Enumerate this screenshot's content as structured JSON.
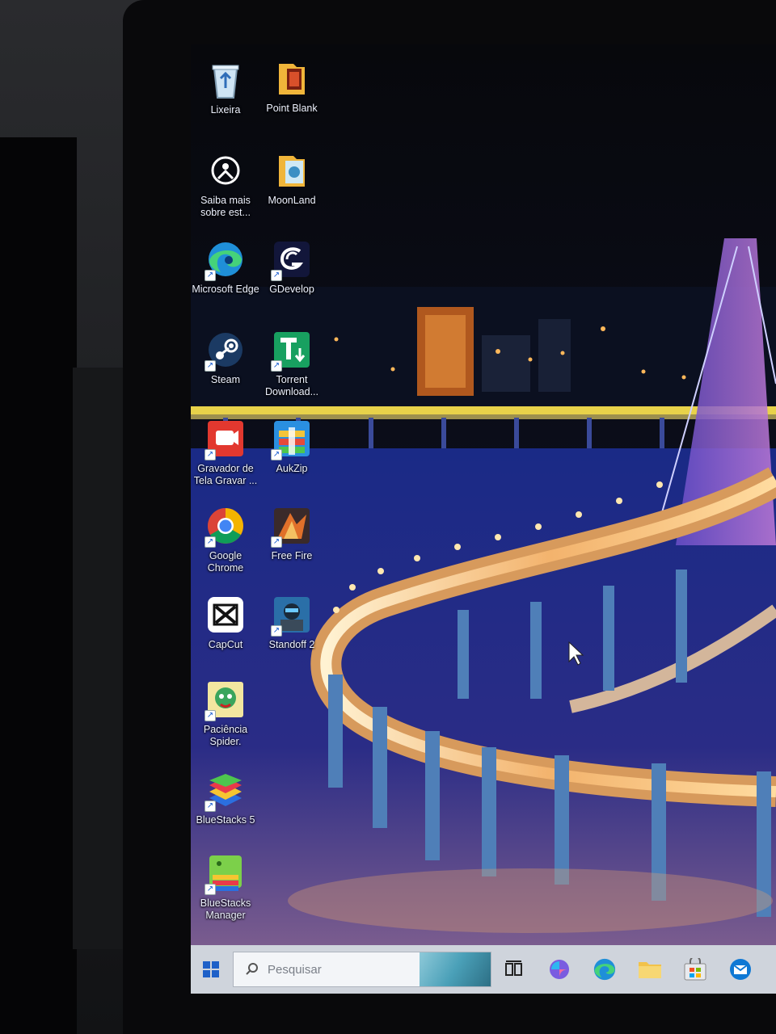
{
  "desktop": {
    "icons": [
      {
        "label": "Lixeira",
        "icon": "recycle-bin-icon"
      },
      {
        "label": "Point Blank",
        "icon": "point-blank-icon"
      },
      {
        "label": "Saiba mais sobre est...",
        "icon": "learn-more-icon"
      },
      {
        "label": "MoonLand",
        "icon": "moonland-icon"
      },
      {
        "label": "Microsoft Edge",
        "icon": "edge-icon"
      },
      {
        "label": "GDevelop",
        "icon": "gdevelop-icon"
      },
      {
        "label": "Steam",
        "icon": "steam-icon"
      },
      {
        "label": "Torrent Download...",
        "icon": "torrent-icon"
      },
      {
        "label": "Gravador de Tela Gravar ...",
        "icon": "screen-recorder-icon"
      },
      {
        "label": "AukZip",
        "icon": "aukzip-icon"
      },
      {
        "label": "Google Chrome",
        "icon": "chrome-icon"
      },
      {
        "label": "Free Fire",
        "icon": "free-fire-icon"
      },
      {
        "label": "CapCut",
        "icon": "capcut-icon"
      },
      {
        "label": "Standoff 2",
        "icon": "standoff2-icon"
      },
      {
        "label": "Paciência Spider.",
        "icon": "spider-solitaire-icon"
      },
      {
        "label": "BlueStacks 5",
        "icon": "bluestacks-icon"
      },
      {
        "label": "BlueStacks Manager",
        "icon": "bluestacks-manager-icon"
      }
    ]
  },
  "taskbar": {
    "search_placeholder": "Pesquisar",
    "items": [
      "start-icon",
      "task-view-icon",
      "copilot-icon",
      "edge-icon",
      "file-explorer-icon",
      "store-icon",
      "mail-icon"
    ]
  },
  "colors": {
    "taskbar": "#cfd4dc",
    "wallpaper_water": "#1c2d8a",
    "bridge_light": "#ffcf8a"
  }
}
